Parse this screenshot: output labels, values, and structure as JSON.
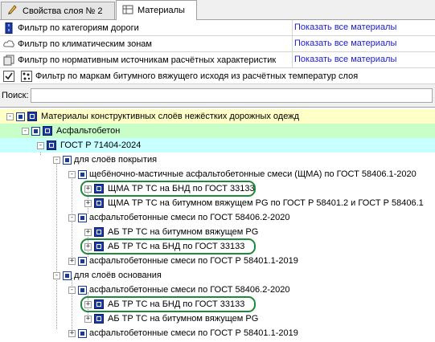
{
  "tabs": [
    {
      "label": "Свойства слоя № 2",
      "icon": "pencil-icon"
    },
    {
      "label": "Материалы",
      "icon": "table-icon"
    }
  ],
  "filters": [
    {
      "label": "Фильтр по категориям дороги",
      "link": "Показать все материалы",
      "icon": "road-icon"
    },
    {
      "label": "Фильтр по климатическим зонам",
      "link": "Показать все материалы",
      "icon": "cloud-icon"
    },
    {
      "label": "Фильтр по нормативным источникам расчётных характеристик",
      "link": "Показать все материалы",
      "icon": "documents-icon"
    },
    {
      "label": "Фильтр по маркам битумного вяжущего исходя из расчётных температур слоя",
      "checked": true,
      "icon": "filter-icon"
    }
  ],
  "search": {
    "label": "Поиск:",
    "value": ""
  },
  "tree": [
    {
      "label": "Материалы конструктивных слоёв нежёстких дорожных одежд"
    },
    {
      "label": "Асфальтобетон"
    },
    {
      "label": "ГОСТ Р 71404-2024"
    },
    {
      "label": "для слоёв покрытия"
    },
    {
      "label": "щебёночно-мастичные асфальтобетонные смеси (ЩМА) по ГОСТ 58406.1-2020"
    },
    {
      "label": "ЩМА ТР ТС на БНД по ГОСТ 33133"
    },
    {
      "label": "ЩМА ТР ТС на битумном вяжущем PG по ГОСТ Р 58401.2 и ГОСТ Р 58406.1"
    },
    {
      "label": "асфальтобетонные смеси по ГОСТ 58406.2-2020"
    },
    {
      "label": "АБ ТР ТС на битумном вяжущем PG"
    },
    {
      "label": "АБ ТР ТС на БНД по ГОСТ 33133"
    },
    {
      "label": "асфальтобетонные смеси по ГОСТ Р 58401.1-2019"
    },
    {
      "label": "для слоёв основания"
    },
    {
      "label": "асфальтобетонные смеси по ГОСТ 58406.2-2020"
    },
    {
      "label": "АБ ТР ТС на БНД по ГОСТ 33133"
    },
    {
      "label": "АБ ТР ТС на битумном вяжущем PG"
    },
    {
      "label": "асфальтобетонные смеси по ГОСТ Р 58401.1-2019"
    }
  ],
  "colors": {
    "root_bg": "#ffffc8",
    "level1_bg": "#c8ffc8",
    "level2_bg": "#c8ffff",
    "highlight_ring": "#1f8a3a",
    "link": "#1a1ad0"
  }
}
